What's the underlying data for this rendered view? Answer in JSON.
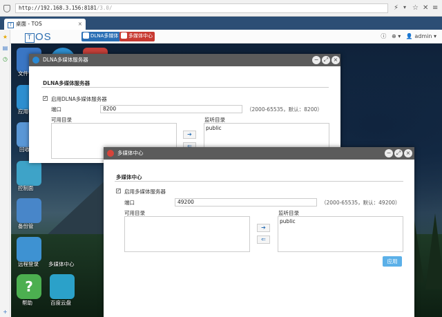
{
  "browser": {
    "url_main": "http://192.168.3.156:8181",
    "url_dim": "/3.0/",
    "tab_title": "桌面 - TOS",
    "tab_close": "×"
  },
  "tos": {
    "logo_letter": "T",
    "logo_text": "OS",
    "taskbar": [
      {
        "label": "DLNA多媒体",
        "color": "#2a6fb5"
      },
      {
        "label": "多媒体中心",
        "color": "#c83a32"
      }
    ],
    "info_icon": "ⓘ",
    "globe_icon": "⊕",
    "user": "admin"
  },
  "desktop": {
    "icons": [
      {
        "label": "文件管",
        "color": "#3a76c4"
      },
      {
        "label": "应用中",
        "color": "#2d8fd0"
      },
      {
        "label": "回收",
        "color": "#5a97d6"
      },
      {
        "label": "控制面",
        "color": "#3ea3c8"
      },
      {
        "label": "备份管",
        "color": "#4886c9"
      },
      {
        "label": "远程登录",
        "color": "#3e92d2"
      },
      {
        "label": "多媒体中心",
        "color": ""
      },
      {
        "label": "帮助",
        "color": "#4caf50"
      },
      {
        "label": "百度云盘",
        "color": "#2ba1c9"
      }
    ]
  },
  "dlna_window": {
    "title": "DLNA多媒体服务器",
    "section": "DLNA多媒体服务器",
    "enable_label": "启用DLNA多媒体服务器",
    "enabled": true,
    "port_label": "端口",
    "port_value": "8200",
    "port_hint": "（2000-65535，默认：8200）",
    "available_label": "可用目录",
    "listening_label": "监听目录",
    "listening_items": [
      "public"
    ],
    "add_arrow": "➔",
    "remove_arrow": "⇐"
  },
  "media_window": {
    "title": "多媒体中心",
    "section": "多媒体中心",
    "enable_label": "启用多媒体服务器",
    "enabled": true,
    "port_label": "端口",
    "port_value": "49200",
    "port_hint": "（2000-65535，默认：49200）",
    "available_label": "可用目录",
    "listening_label": "监听目录",
    "listening_items": [
      "public"
    ],
    "add_arrow": "➔",
    "remove_arrow": "⇐",
    "apply_label": "应用"
  },
  "window_controls": {
    "minimize": "−",
    "maximize": "⤢",
    "close": "×"
  }
}
